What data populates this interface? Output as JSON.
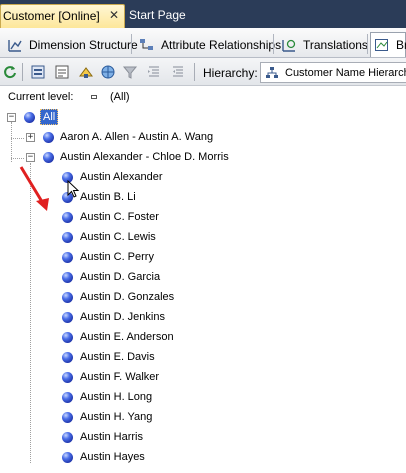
{
  "document_tabs": {
    "active": {
      "label": "Customer [Online]",
      "close": "✕"
    },
    "inactive": {
      "label": "Start Page"
    }
  },
  "designer_tabs": [
    {
      "label": "Dimension Structure",
      "icon": "dimension-structure-icon"
    },
    {
      "label": "Attribute Relationships",
      "icon": "attribute-relationships-icon"
    },
    {
      "label": "Translations",
      "icon": "translations-icon"
    },
    {
      "label": "Br",
      "icon": "browser-icon"
    }
  ],
  "toolbar": {
    "hierarchy_label": "Hierarchy:",
    "hierarchy_value": "Customer Name Hierarchy"
  },
  "current_level": {
    "label": "Current level:",
    "value": "(All)"
  },
  "tree": {
    "root": {
      "label": "All",
      "expander": "−"
    },
    "groups": [
      {
        "label": "Aaron A. Allen - Austin A. Wang",
        "expander": "+"
      },
      {
        "label": "Austin Alexander - Chloe D. Morris",
        "expander": "−"
      }
    ],
    "members": [
      "Austin Alexander",
      "Austin B. Li",
      "Austin C. Foster",
      "Austin C. Lewis",
      "Austin C. Perry",
      "Austin D. Garcia",
      "Austin D. Gonzales",
      "Austin D. Jenkins",
      "Austin E. Anderson",
      "Austin E. Davis",
      "Austin F. Walker",
      "Austin H. Long",
      "Austin H. Yang",
      "Austin Harris",
      "Austin Hayes"
    ]
  },
  "colors": {
    "doc_tab_strip": "#2b3c58",
    "active_tab": "#fde79a",
    "member_icon": "#2f4fd0",
    "selection": "#3366cc",
    "annotation_arrow": "#e02020"
  }
}
